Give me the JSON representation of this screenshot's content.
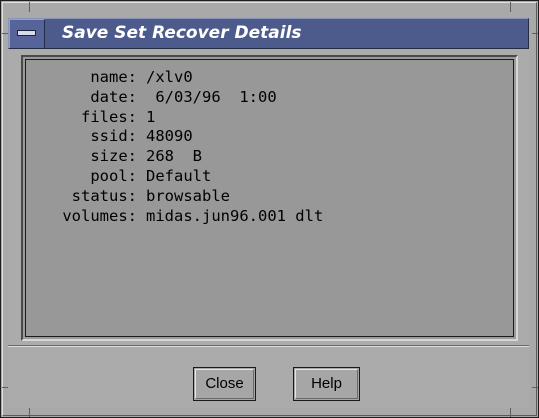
{
  "window": {
    "title": "Save Set Recover Details",
    "titlebar_color": "#4d5a8c",
    "menu_icon": "window-menu-icon"
  },
  "details": [
    {
      "label": "name:",
      "value": "/xlv0"
    },
    {
      "label": "date:",
      "value": " 6/03/96  1:00"
    },
    {
      "label": "files:",
      "value": "1"
    },
    {
      "label": "ssid:",
      "value": "48090"
    },
    {
      "label": "size:",
      "value": "268  B"
    },
    {
      "label": "pool:",
      "value": "Default"
    },
    {
      "label": "status:",
      "value": "browsable"
    },
    {
      "label": "volumes:",
      "value": "midas.jun96.001 dlt"
    }
  ],
  "buttons": {
    "close_label": "Close",
    "help_label": "Help"
  }
}
